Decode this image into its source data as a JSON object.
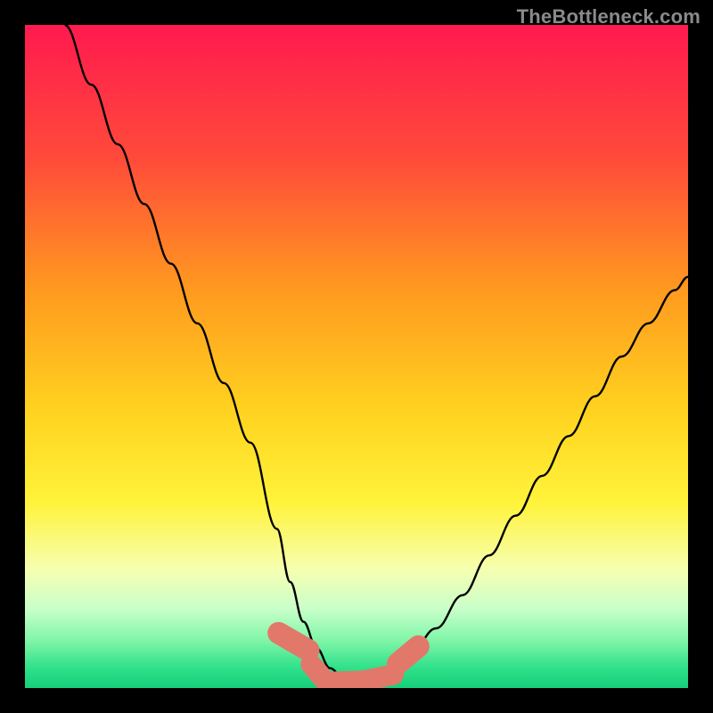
{
  "watermark": "TheBottleneck.com",
  "colors": {
    "frame": "#000000",
    "gradient_stops": [
      {
        "pos": 0.0,
        "color": "#ff1a4f"
      },
      {
        "pos": 0.2,
        "color": "#ff4a3a"
      },
      {
        "pos": 0.4,
        "color": "#ff9a1f"
      },
      {
        "pos": 0.58,
        "color": "#ffd21f"
      },
      {
        "pos": 0.72,
        "color": "#fff33a"
      },
      {
        "pos": 0.82,
        "color": "#f6ffb0"
      },
      {
        "pos": 0.88,
        "color": "#caffca"
      },
      {
        "pos": 0.93,
        "color": "#7cf5a6"
      },
      {
        "pos": 0.97,
        "color": "#2fe08a"
      },
      {
        "pos": 1.0,
        "color": "#17cf7a"
      }
    ],
    "curve": "#000000",
    "link_stroke": "#e2786a",
    "link_fill": "#e2786a"
  },
  "chart_data": {
    "type": "line",
    "title": "",
    "xlabel": "",
    "ylabel": "",
    "xlim": [
      0,
      100
    ],
    "ylim": [
      0,
      100
    ],
    "grid": false,
    "legend": false,
    "series": [
      {
        "name": "bottleneck-curve",
        "x": [
          6,
          10,
          14,
          18,
          22,
          26,
          30,
          34,
          38,
          40,
          42,
          44,
          46,
          48,
          50,
          52,
          54,
          58,
          62,
          66,
          70,
          74,
          78,
          82,
          86,
          90,
          94,
          98,
          100
        ],
        "y": [
          100,
          91,
          82,
          73,
          64,
          55,
          46,
          37,
          24,
          16,
          10,
          6,
          3,
          1.5,
          1,
          1.2,
          2,
          5,
          9,
          14,
          20,
          26,
          32,
          38,
          44,
          50,
          55,
          60,
          62
        ]
      }
    ],
    "annotations": {
      "links_near_trough": [
        {
          "cx": 40.5,
          "cy": 7.0,
          "rx": 1.6,
          "ry": 4.2,
          "rot": -60
        },
        {
          "cx": 44.5,
          "cy": 2.0,
          "rx": 1.5,
          "ry": 3.6,
          "rot": -40
        },
        {
          "cx": 49.0,
          "cy": 1.0,
          "rx": 1.5,
          "ry": 4.4,
          "rot": 88
        },
        {
          "cx": 53.5,
          "cy": 1.6,
          "rx": 1.5,
          "ry": 3.6,
          "rot": 78
        },
        {
          "cx": 57.8,
          "cy": 5.0,
          "rx": 1.6,
          "ry": 3.6,
          "rot": 50
        }
      ]
    }
  }
}
